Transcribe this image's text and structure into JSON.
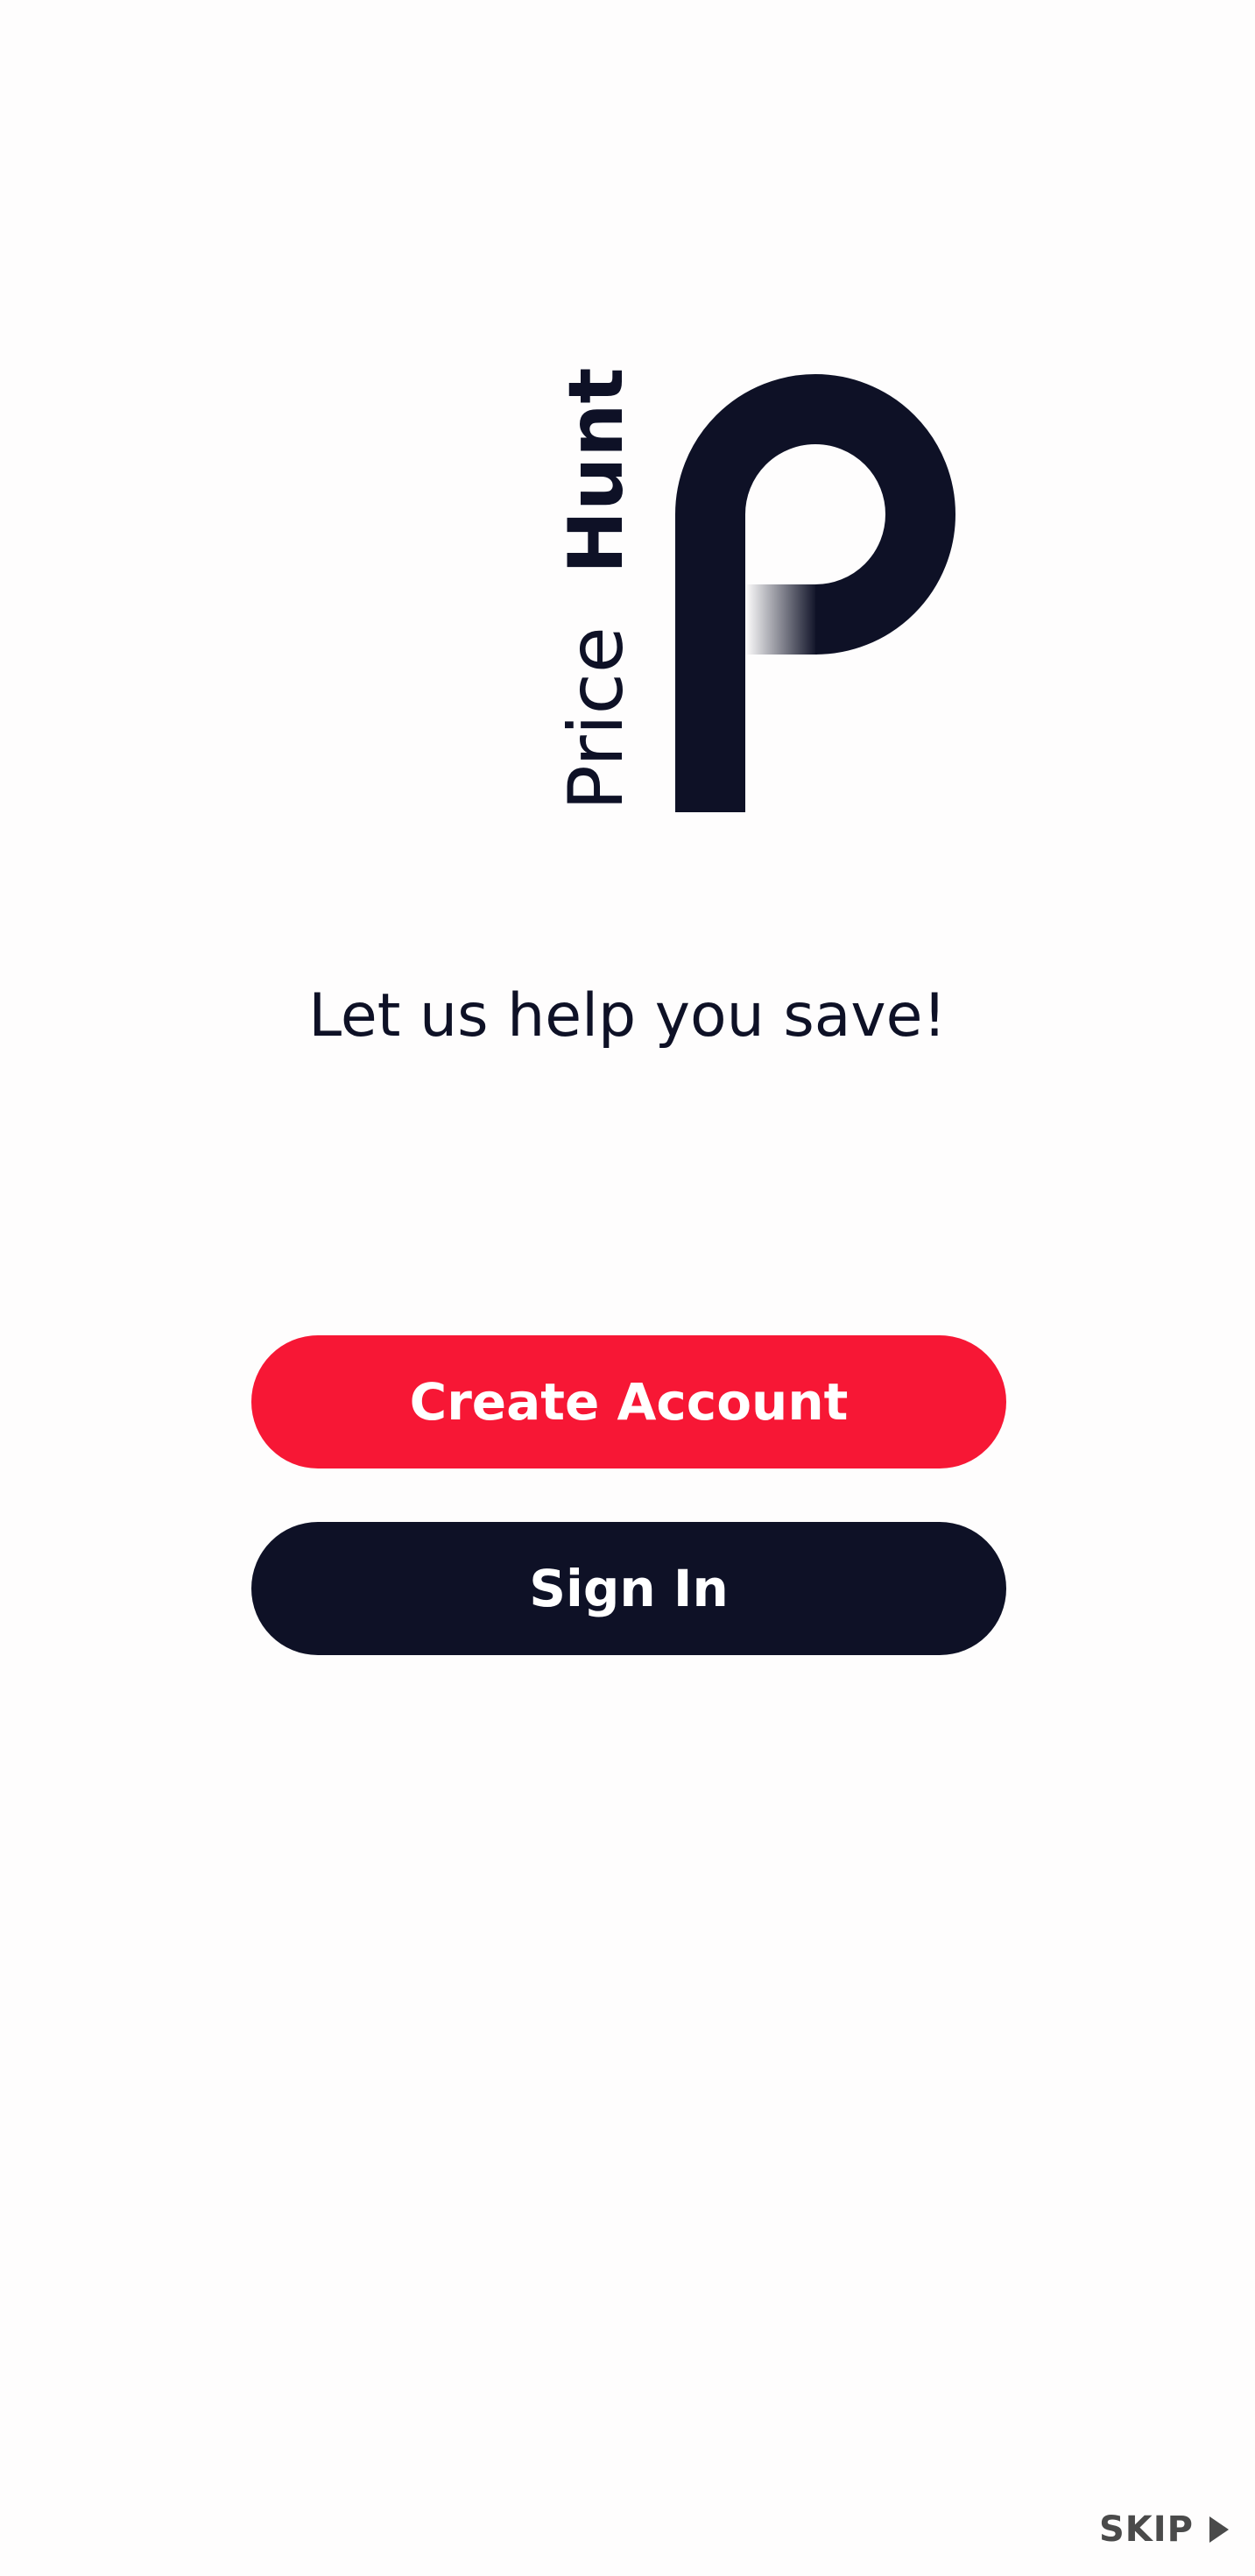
{
  "logo": {
    "word_regular": "Price",
    "word_bold": "Hunt",
    "color": "#0e1126"
  },
  "tagline": "Let us help you save!",
  "buttons": {
    "create_account": "Create Account",
    "sign_in": "Sign In"
  },
  "skip": {
    "label": "SKIP",
    "icon": "play-triangle-icon"
  },
  "colors": {
    "background": "#fefdfd",
    "primary": "#f71735",
    "dark": "#0e1126",
    "muted": "#4a4a4a"
  }
}
